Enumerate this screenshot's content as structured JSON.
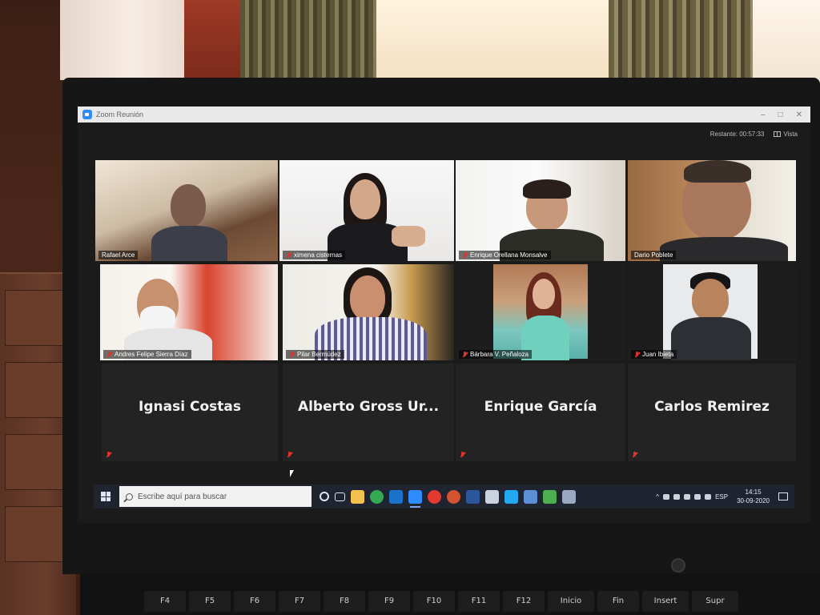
{
  "window": {
    "title": "Zoom Reunión",
    "controls": [
      "–",
      "□",
      "✕"
    ]
  },
  "topbar": {
    "remaining": "Restante: 00:57:33",
    "view_label": "Vista"
  },
  "participants_video": [
    {
      "name": "Rafael Arce",
      "muted": false,
      "active": false
    },
    {
      "name": "ximena cisternas",
      "muted": true,
      "active": false
    },
    {
      "name": "Enrique Orellana Monsalve",
      "muted": true,
      "active": false
    },
    {
      "name": "Dario Poblete",
      "muted": false,
      "active": true
    },
    {
      "name": "Andres Felipe Sierra Díaz",
      "muted": true,
      "active": false
    },
    {
      "name": "Pilar Bermúdez",
      "muted": true,
      "active": false
    },
    {
      "name": "Bárbara V. Peñaloza",
      "muted": true,
      "active": false
    },
    {
      "name": "Juan Ibieta",
      "muted": true,
      "active": false
    }
  ],
  "participants_no_video": [
    {
      "name": "Ignasi Costas",
      "muted": true
    },
    {
      "name": "Alberto Gross Ur...",
      "muted": true
    },
    {
      "name": "Enrique García",
      "muted": true
    },
    {
      "name": "Carlos Remirez",
      "muted": true
    }
  ],
  "taskbar": {
    "search_placeholder": "Escribe aquí para buscar",
    "language": "ESP",
    "time": "14:15",
    "date": "30-09-2020",
    "apps": [
      "file-explorer-icon",
      "chrome-icon",
      "outlook-icon",
      "zoom-icon",
      "youtube-icon",
      "powerpoint-icon",
      "word-icon",
      "window-icon",
      "vscode-icon",
      "tablet-icon",
      "green-app-icon",
      "office-icon"
    ],
    "colors": {
      "file-explorer-icon": "#f2c14e",
      "chrome-icon": "#34a853",
      "outlook-icon": "#1a73c9",
      "zoom-icon": "#2d8cff",
      "youtube-icon": "#e23a2e",
      "powerpoint-icon": "#d35230",
      "word-icon": "#2b579a",
      "window-icon": "#c9d2de",
      "vscode-icon": "#23a9f2",
      "tablet-icon": "#5b8fd6",
      "green-app-icon": "#4caf50",
      "office-icon": "#9aa8c2"
    }
  },
  "keyboard": {
    "fkeys": [
      "F4",
      "F5",
      "F6",
      "F7",
      "F8",
      "F9",
      "F10",
      "F11",
      "F12",
      "Inicio",
      "Fin",
      "Insert",
      "Supr"
    ]
  },
  "colors": {
    "active_speaker": "#b8d43a",
    "muted": "#e0332b",
    "tile_bg": "#232323"
  }
}
